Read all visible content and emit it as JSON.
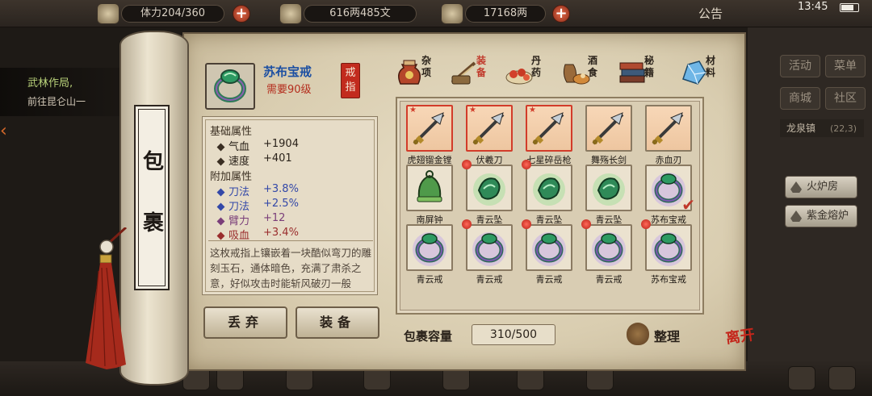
{
  "topbar": {
    "stamina": "体力204/360",
    "money": "616两485文",
    "gold": "17168两",
    "notice": "公告",
    "clock": "13:45"
  },
  "quest": {
    "title": "武林作局,",
    "desc": "前往昆仑山一"
  },
  "right_panel": {
    "buttons": [
      "活动",
      "菜单",
      "商城",
      "社区"
    ],
    "location": "龙泉镇",
    "coord": "(22,3)",
    "side_buttons": [
      "火炉房",
      "紫金熔炉"
    ]
  },
  "scroll": {
    "title_chars": [
      "包",
      "裹"
    ]
  },
  "item": {
    "name": "苏布宝戒",
    "level_req": "需要90级",
    "type_tag": "戒指",
    "base_header": "基础属性",
    "base_stats": [
      {
        "name": "气血",
        "value": "+1904"
      },
      {
        "name": "速度",
        "value": "+401"
      }
    ],
    "extra_header": "附加属性",
    "extra_stats": [
      {
        "name": "刀法",
        "value": "+3.8%"
      },
      {
        "name": "刀法",
        "value": "+2.5%"
      },
      {
        "name": "臂力",
        "value": "+12"
      },
      {
        "name": "吸血",
        "value": "+3.4%"
      }
    ],
    "description": "这枚戒指上镶嵌着一块酷似弯刀的雕刻玉石，通体暗色，充满了肃杀之意，好似攻击时能斩风破刃一般"
  },
  "buttons": {
    "discard": "丢弃",
    "equip": "装备"
  },
  "categories": [
    {
      "label": "杂项",
      "icon": "jar-icon",
      "active": false
    },
    {
      "label": "装备",
      "icon": "equipment-icon",
      "active": true
    },
    {
      "label": "丹药",
      "icon": "pills-icon",
      "active": false
    },
    {
      "label": "酒食",
      "icon": "wine-food-icon",
      "active": false
    },
    {
      "label": "秘籍",
      "icon": "books-icon",
      "active": false
    },
    {
      "label": "材料",
      "icon": "crystal-icon",
      "active": false
    }
  ],
  "slots": [
    {
      "name": "虎翅镏金镗",
      "kind": "weapon",
      "icon": "trident-icon",
      "star": true,
      "dot": false,
      "check": false
    },
    {
      "name": "伏羲刀",
      "kind": "weapon",
      "icon": "sword-icon",
      "star": true,
      "dot": false,
      "check": false
    },
    {
      "name": "七星碎岳枪",
      "kind": "weapon",
      "icon": "spear-icon",
      "star": true,
      "dot": false,
      "check": false
    },
    {
      "name": "舞殇长剑",
      "kind": "weapon",
      "icon": "long-sword-icon",
      "star": false,
      "dot": false,
      "check": false
    },
    {
      "name": "赤血刃",
      "kind": "weapon",
      "icon": "blade-icon",
      "star": false,
      "dot": false,
      "check": false
    },
    {
      "name": "南屏钟",
      "kind": "bell",
      "icon": "bell-icon",
      "star": false,
      "dot": false,
      "check": false
    },
    {
      "name": "青云坠",
      "kind": "pendant",
      "icon": "jade-pendant-icon",
      "star": false,
      "dot": true,
      "check": false
    },
    {
      "name": "青云坠",
      "kind": "pendant",
      "icon": "jade-pendant-icon",
      "star": false,
      "dot": true,
      "check": false
    },
    {
      "name": "青云坠",
      "kind": "pendant",
      "icon": "jade-pendant-icon",
      "star": false,
      "dot": false,
      "check": false
    },
    {
      "name": "苏布宝戒",
      "kind": "ring",
      "icon": "ring-icon",
      "star": false,
      "dot": false,
      "check": true
    },
    {
      "name": "青云戒",
      "kind": "ring",
      "icon": "ring-icon",
      "star": false,
      "dot": false,
      "check": false
    },
    {
      "name": "青云戒",
      "kind": "ring",
      "icon": "ring-icon",
      "star": false,
      "dot": true,
      "check": false
    },
    {
      "name": "青云戒",
      "kind": "ring",
      "icon": "ring-icon",
      "star": false,
      "dot": true,
      "check": false
    },
    {
      "name": "青云戒",
      "kind": "ring",
      "icon": "ring-icon",
      "star": false,
      "dot": true,
      "check": false
    },
    {
      "name": "苏布宝戒",
      "kind": "ring",
      "icon": "ring-icon",
      "star": false,
      "dot": true,
      "check": false
    }
  ],
  "capacity": {
    "label": "包裹容量",
    "value": "310/500"
  },
  "sort_label": "整理",
  "leave_label": "离开",
  "colors": {
    "parchment": "#e3d7bd",
    "item_name": "#1c4fa2",
    "level_req": "#b42c1c",
    "extra_stat": "#3348a8",
    "accent_red": "#c22b1e"
  }
}
